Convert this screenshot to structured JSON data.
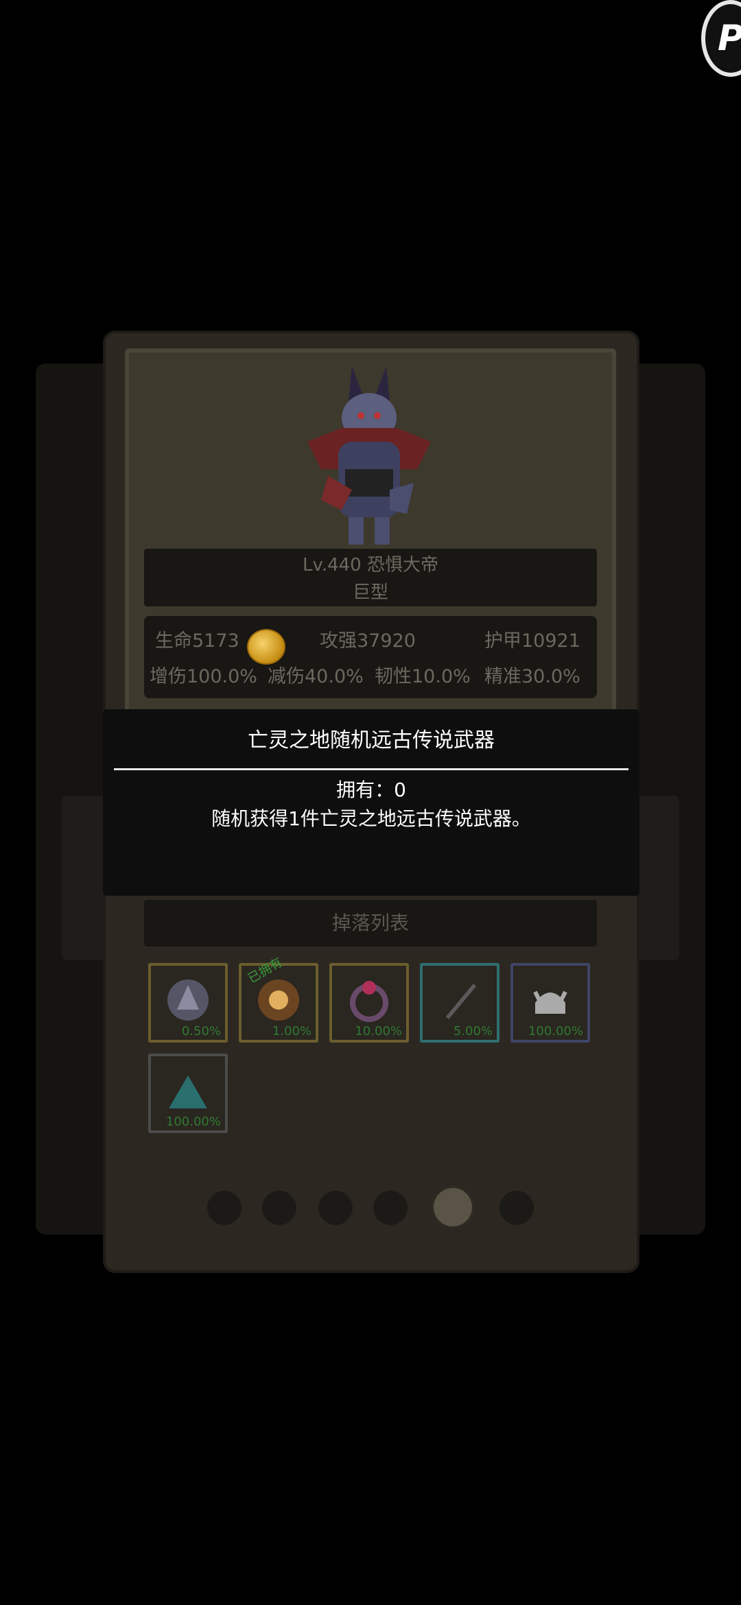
{
  "corner_button": {
    "label": "P"
  },
  "boss": {
    "level_name": "Lv.440 恐惧大帝",
    "size": "巨型"
  },
  "stats": {
    "hp": "生命5173",
    "attack": "攻强37920",
    "armor": "护甲10921",
    "dmg_up": "增伤100.0%",
    "dmg_reduce": "减伤40.0%",
    "toughness": "韧性10.0%",
    "accuracy": "精准30.0%"
  },
  "drop_list": {
    "header": "掉落列表",
    "items": [
      {
        "icon": "armor-icon",
        "percent": "0.50%",
        "tag": "",
        "border": "#6b5e2e"
      },
      {
        "icon": "orb-icon",
        "percent": "1.00%",
        "tag": "已拥有",
        "border": "#6b5e2e"
      },
      {
        "icon": "ring-icon",
        "percent": "10.00%",
        "tag": "",
        "border": "#6b5e2e"
      },
      {
        "icon": "dagger-icon",
        "percent": "5.00%",
        "tag": "",
        "border": "#2f6f6f"
      },
      {
        "icon": "helmet-icon",
        "percent": "100.00%",
        "tag": "",
        "border": "#3f4566"
      },
      {
        "icon": "crystal-icon",
        "percent": "100.00%",
        "tag": "",
        "border": "#4c4c4c"
      }
    ]
  },
  "pager": {
    "count": 6,
    "active_index": 4
  },
  "tooltip": {
    "title": "亡灵之地随机远古传说武器",
    "owned": "拥有：0",
    "description": "随机获得1件亡灵之地远古传说武器。"
  }
}
